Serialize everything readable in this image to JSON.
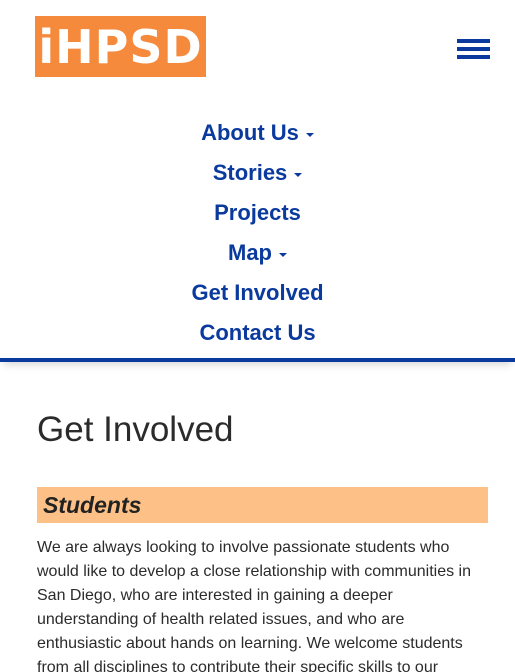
{
  "header": {
    "logo_text": "iHPSD",
    "menu_icon": "hamburger-menu-icon",
    "colors": {
      "accent": "#0b3a9e",
      "logo_bg": "#f58a3c"
    }
  },
  "nav": {
    "items": [
      {
        "label": "About Us",
        "has_dropdown": true
      },
      {
        "label": "Stories",
        "has_dropdown": true
      },
      {
        "label": "Projects",
        "has_dropdown": false
      },
      {
        "label": "Map",
        "has_dropdown": true
      },
      {
        "label": "Get Involved",
        "has_dropdown": false
      },
      {
        "label": "Contact Us",
        "has_dropdown": false
      }
    ]
  },
  "main": {
    "title": "Get Involved",
    "sections": [
      {
        "heading": "Students",
        "heading_bg": "#fdc187",
        "text": "We are always looking to involve passionate students who would like to develop a close relationship with communities in San Diego, who are interested in gaining a deeper understanding of health related issues, and who are enthusiastic about hands on learning. We welcome students from all disciplines to contribute their specific skills to our"
      }
    ]
  }
}
